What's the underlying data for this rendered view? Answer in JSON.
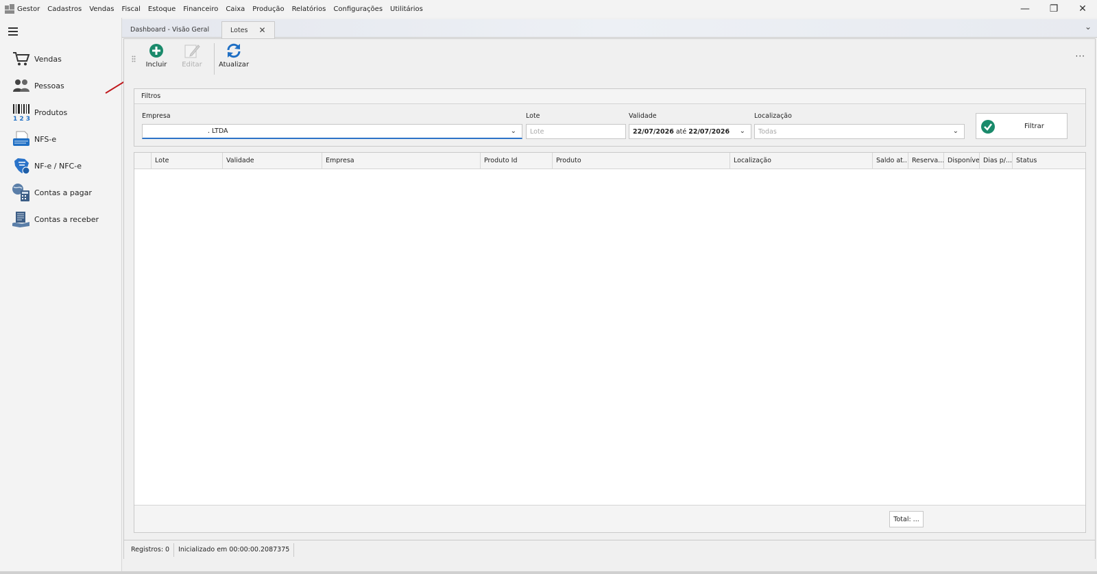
{
  "menubar": {
    "items": [
      "Gestor",
      "Cadastros",
      "Vendas",
      "Fiscal",
      "Estoque",
      "Financeiro",
      "Caixa",
      "Produção",
      "Relatórios",
      "Configurações",
      "Utilitários"
    ],
    "window_controls": {
      "minimize": "—",
      "restore": "❐",
      "close": "✕"
    }
  },
  "sidebar": {
    "items": [
      {
        "label": "Vendas",
        "icon": "cart-icon"
      },
      {
        "label": "Pessoas",
        "icon": "people-icon"
      },
      {
        "label": "Produtos",
        "icon": "barcode-icon"
      },
      {
        "label": "NFS-e",
        "icon": "nfse-icon"
      },
      {
        "label": "NF-e / NFC-e",
        "icon": "nfe-icon"
      },
      {
        "label": "Contas a pagar",
        "icon": "payables-icon"
      },
      {
        "label": "Contas a receber",
        "icon": "receivables-icon"
      }
    ]
  },
  "tabs": [
    {
      "label": "Dashboard - Visão Geral"
    },
    {
      "label": "Lotes",
      "close": "✕"
    }
  ],
  "tab_dropdown": "⌄",
  "toolbar": {
    "incluir": "Incluir",
    "editar": "Editar",
    "atualizar": "Atualizar",
    "more": "···"
  },
  "filters": {
    "title": "Filtros",
    "empresa_label": "Empresa",
    "empresa_value": ". LTDA",
    "lote_label": "Lote",
    "lote_placeholder": "Lote",
    "validade_label": "Validade",
    "validade_from": "22/07/2026",
    "validade_sep": "até",
    "validade_to": "22/07/2026",
    "localizacao_label": "Localização",
    "localizacao_placeholder": "Todas",
    "filtrar": "Filtrar"
  },
  "grid": {
    "columns": [
      "Lote",
      "Validade",
      "Empresa",
      "Produto Id",
      "Produto",
      "Localização",
      "Saldo at...",
      "Reserva...",
      "Disponível",
      "Dias p/...",
      "Status"
    ],
    "total": "Total: ..."
  },
  "statusbar": {
    "registros": "Registros: 0",
    "inicializado": "Inicializado em 00:00:00.2087375"
  },
  "colors": {
    "accent_green": "#1a8a6b",
    "accent_blue": "#1f6fc4",
    "arrow_red": "#c0181c"
  }
}
